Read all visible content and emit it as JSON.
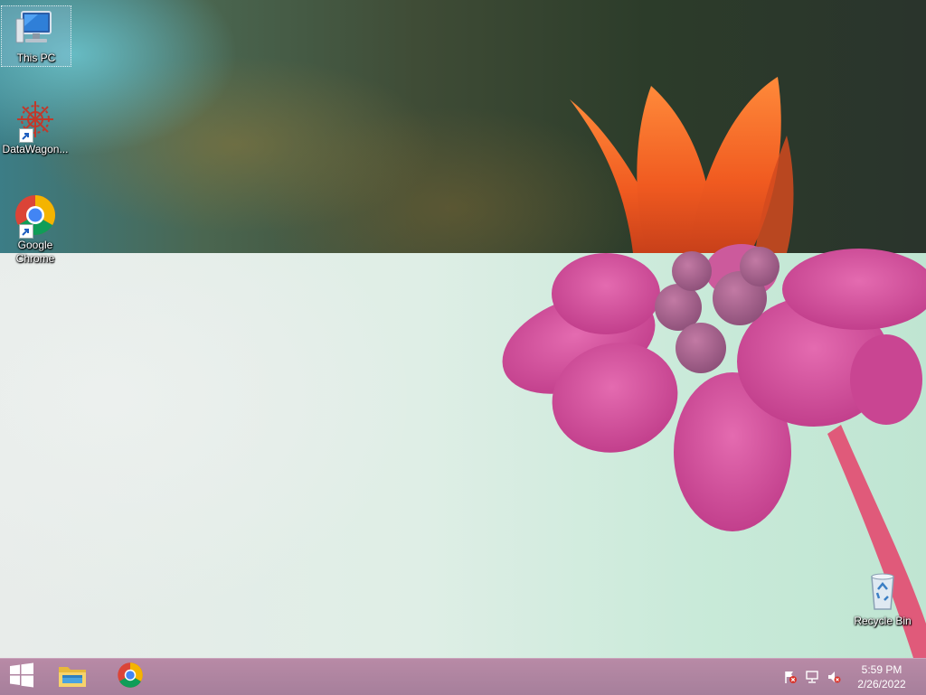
{
  "desktop": {
    "icons": [
      {
        "label": "This PC",
        "icon": "computer-icon"
      },
      {
        "label": "DataWagon...",
        "icon": "datawagon-icon"
      },
      {
        "label": "Google Chrome",
        "icon": "chrome-icon"
      },
      {
        "label": "Recycle Bin",
        "icon": "recycle-bin-icon"
      }
    ]
  },
  "taskbar": {
    "start_icon": "windows-logo-icon",
    "pinned": [
      {
        "name": "File Explorer",
        "icon": "folder-icon"
      },
      {
        "name": "Google Chrome",
        "icon": "chrome-icon"
      }
    ],
    "tray": {
      "icons": [
        "action-center-flag-icon",
        "network-icon",
        "volume-muted-icon"
      ],
      "time": "5:59 PM",
      "date": "2/26/2022"
    }
  },
  "colors": {
    "taskbar": "#a67f9b",
    "accent_flower_orange": "#f06a2a",
    "accent_flower_pink": "#d44a9c"
  }
}
